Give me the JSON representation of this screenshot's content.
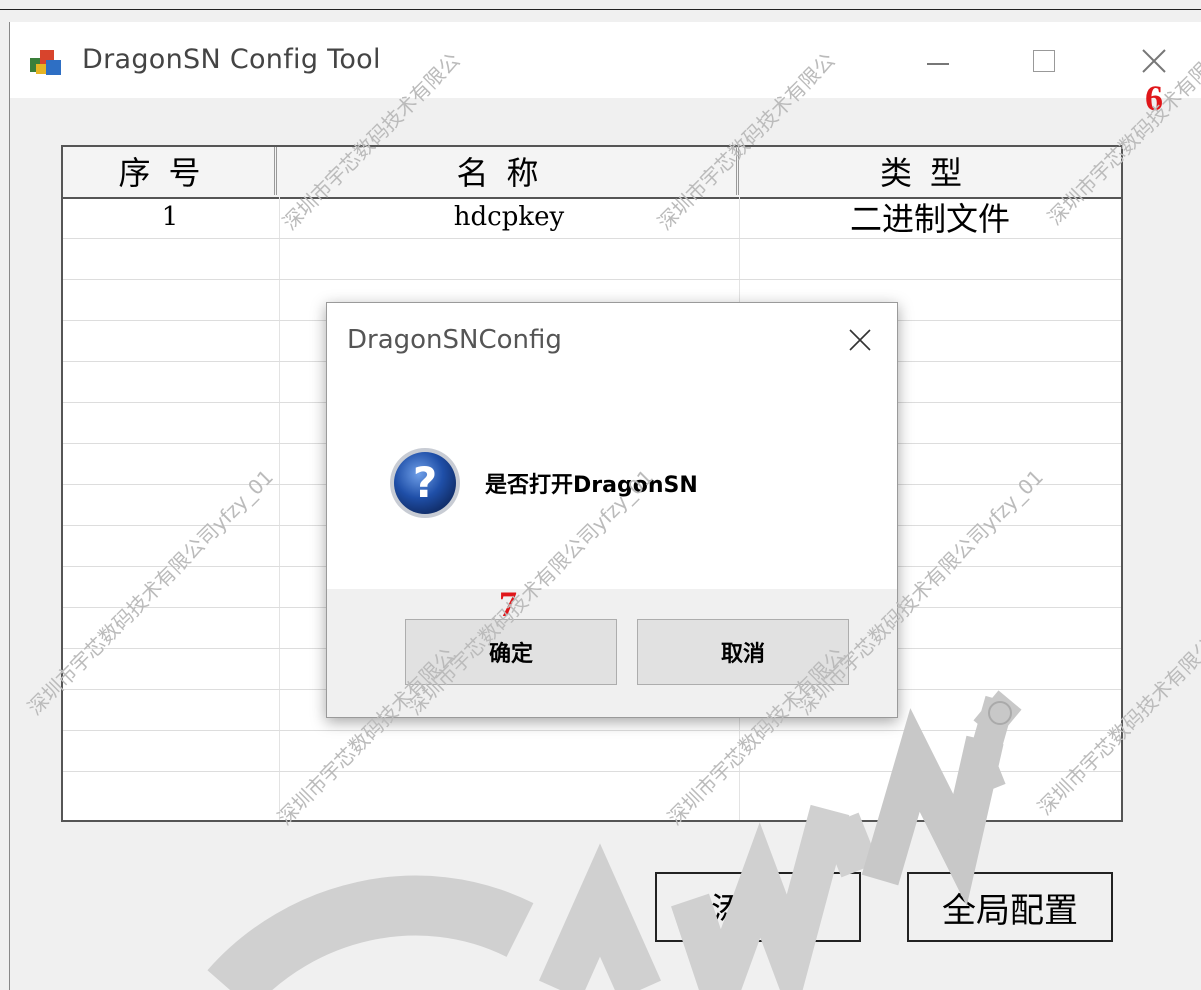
{
  "window": {
    "title": "DragonSN Config Tool",
    "controls": {
      "minimize": "minimize-icon",
      "maximize": "maximize-icon",
      "close": "close-icon"
    }
  },
  "annotations": {
    "close_step": "6",
    "ok_step": "7"
  },
  "table": {
    "headers": [
      "序号",
      "名称",
      "类型"
    ],
    "rows": [
      {
        "index": "1",
        "name": "hdcpkey",
        "type": "二进制文件"
      }
    ]
  },
  "buttons": {
    "add": "添加",
    "global_config": "全局配置"
  },
  "dialog": {
    "title": "DragonSNConfig",
    "message": "是否打开DragonSN",
    "icon": "question-icon",
    "ok": "确定",
    "cancel": "取消"
  },
  "watermarks": {
    "company": "深圳市宇芯数码技术有限公司yfzy_01",
    "company_short": "深圳市宇芯数码技术有限公",
    "logo_text": "ALLWINNER",
    "registered_mark": "®"
  },
  "colors": {
    "annotation_red": "#e0161a",
    "question_blue": "#1f4fa8",
    "logo_gray": "#cfcfcf"
  }
}
